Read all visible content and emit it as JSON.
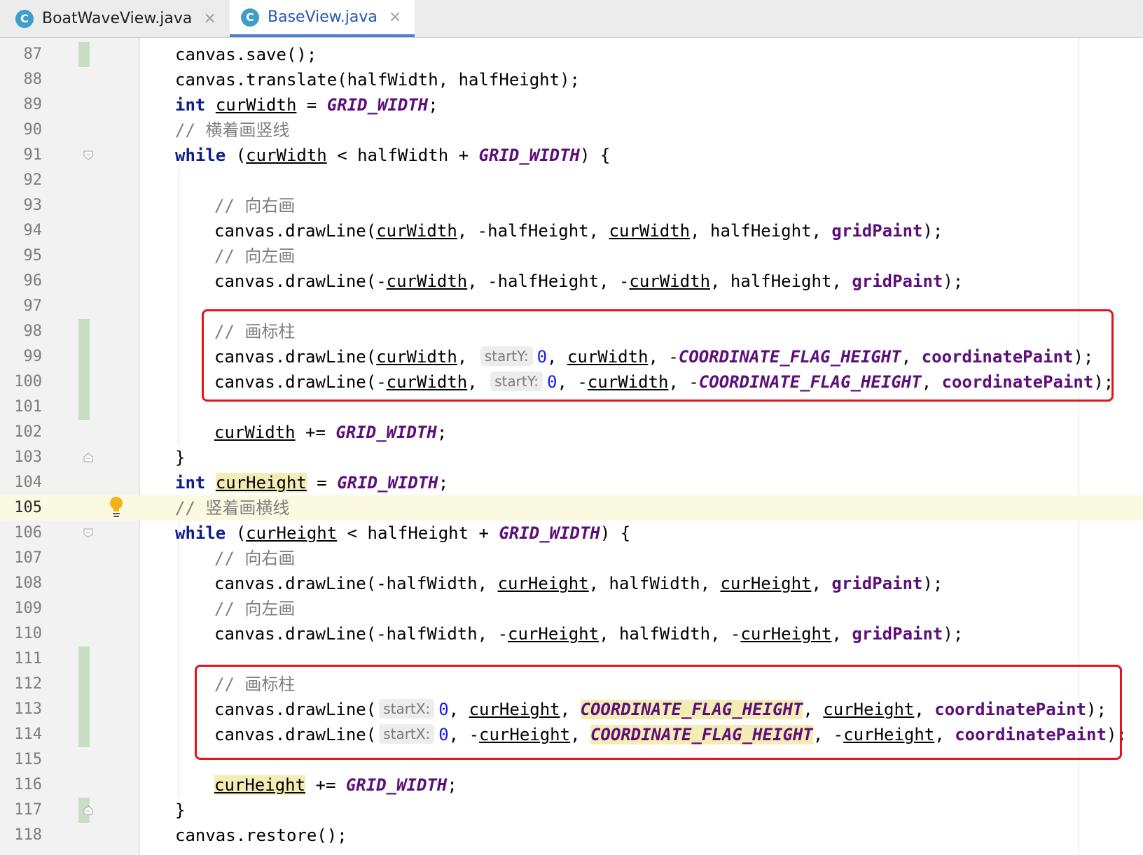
{
  "tabs": [
    {
      "label": "BoatWaveView.java",
      "icon": "class-c-icon",
      "active": false
    },
    {
      "label": "BaseView.java",
      "icon": "class-c-icon",
      "active": true
    }
  ],
  "tab_icon_letter": "C",
  "close_glyph": "×",
  "hints": {
    "startY": "startY:",
    "startX": "startX:"
  },
  "comments": {
    "horizontal_vertical": "// 横着画竖线",
    "draw_right": "// 向右画",
    "draw_left": "// 向左画",
    "draw_flag": "// 画标柱",
    "vertical_horizontal": "// 竖着画横线"
  },
  "line_numbers": [
    "87",
    "88",
    "89",
    "90",
    "91",
    "92",
    "93",
    "94",
    "95",
    "96",
    "97",
    "98",
    "99",
    "100",
    "101",
    "102",
    "103",
    "104",
    "105",
    "106",
    "107",
    "108",
    "109",
    "110",
    "111",
    "112",
    "113",
    "114",
    "115",
    "116",
    "117",
    "118"
  ],
  "current_line": "105",
  "colors": {
    "keyword": "#0b1f8a",
    "constant": "#5c0f7a",
    "comment": "#7f7f7f",
    "number": "#1a1af0",
    "highlight_box": "#e5141b",
    "vcs_change": "#c9dfc3"
  }
}
